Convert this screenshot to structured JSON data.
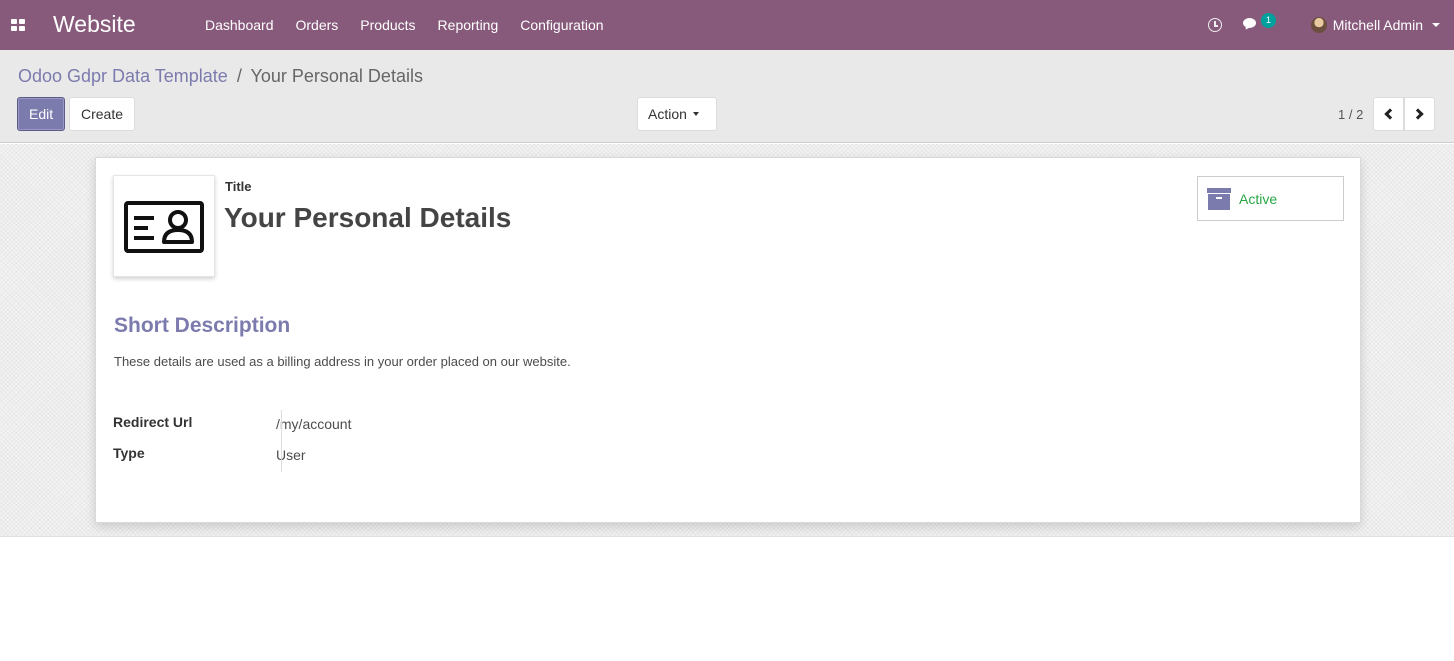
{
  "navbar": {
    "app_name": "Website",
    "menu": [
      "Dashboard",
      "Orders",
      "Products",
      "Reporting",
      "Configuration"
    ],
    "chat_badge": "1",
    "user_name": "Mitchell Admin",
    "color": "#875a7b"
  },
  "breadcrumb": {
    "parent": "Odoo Gdpr Data Template",
    "separator": "/",
    "current": "Your Personal Details"
  },
  "buttons": {
    "edit": "Edit",
    "create": "Create",
    "action": "Action"
  },
  "pager": {
    "value": "1 / 2"
  },
  "record": {
    "title_label": "Title",
    "title": "Your Personal Details",
    "active_label": "Active",
    "active_color": "#28a745",
    "section_heading": "Short Description",
    "description": "These details are used as a billing address in your order placed on our website.",
    "fields": [
      {
        "label": "Redirect Url",
        "value": "/my/account"
      },
      {
        "label": "Type",
        "value": "User"
      }
    ]
  },
  "icons": {
    "apps": "apps-grid-icon",
    "clock": "clock-icon",
    "chat": "chat-icon",
    "record_image": "id-card-icon",
    "archive": "archive-icon"
  }
}
